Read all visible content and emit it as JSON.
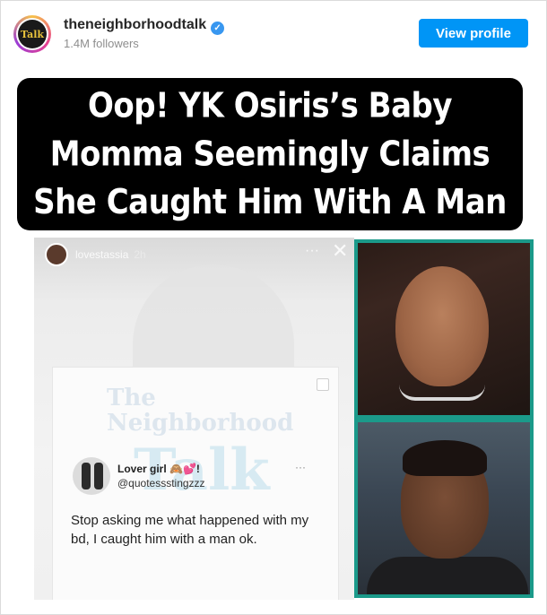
{
  "header": {
    "avatar_text": "Talk",
    "username": "theneighborhoodtalk",
    "verified_glyph": "✓",
    "followers": "1.4M followers",
    "view_profile_label": "View profile"
  },
  "headline": {
    "text": "Oop! YK Osiris’s Baby Momma Seemingly Claims She Caught Him With A Man"
  },
  "story": {
    "username": "lovestassia",
    "time": "2h",
    "more_glyph": "···",
    "close_glyph": "✕",
    "watermark": {
      "line1": "The",
      "line2": "Neighborhood",
      "line3": "Talk"
    },
    "tweet": {
      "display_name": "Lover girl 🙈💕!",
      "handle": "@quotessstingzzz",
      "more_glyph": "···",
      "text": "Stop asking me what happened with my bd, I caught him with a man ok."
    }
  },
  "colors": {
    "button_blue": "#0095f6",
    "verified_blue": "#3897f0",
    "photo_border_teal": "#1b9a8a",
    "headline_bg": "#000000"
  },
  "icons": {
    "verified": "verified-badge-icon",
    "story_more": "more-dots-icon",
    "story_close": "close-icon",
    "checkbox": "checkbox-icon"
  }
}
